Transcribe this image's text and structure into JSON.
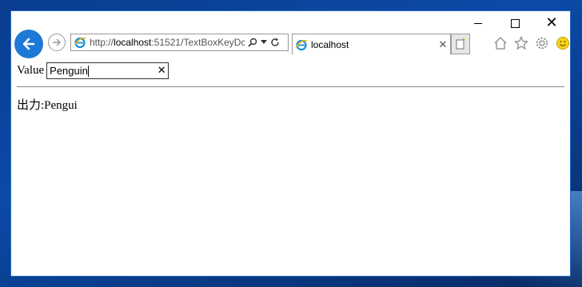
{
  "browser": {
    "address_prefix": "http://",
    "address_host": "localhost",
    "address_rest": ":51521/TextBoxKeyDc",
    "tab_title": "localhost",
    "tab_close": "✕",
    "window_close": "✕"
  },
  "form": {
    "label": "Value",
    "input_value": "Penguin",
    "clear_glyph": "✕"
  },
  "output": {
    "text": "出力:Pengui"
  }
}
